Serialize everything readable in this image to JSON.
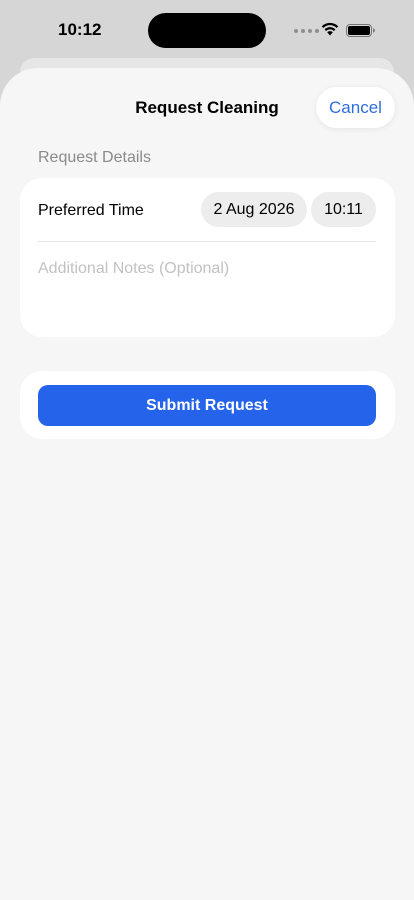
{
  "status_bar": {
    "time": "10:12",
    "icons": [
      "signal-dots-icon",
      "wifi-icon",
      "battery-icon"
    ]
  },
  "nav": {
    "title": "Request Cleaning",
    "cancel_label": "Cancel"
  },
  "details": {
    "section_header": "Request Details",
    "preferred_time_label": "Preferred Time",
    "date_value": "2 Aug 2026",
    "time_value": "10:11",
    "notes_value": "",
    "notes_placeholder": "Additional Notes (Optional)"
  },
  "submit": {
    "label": "Submit Request"
  },
  "colors": {
    "accent": "#2563eb",
    "link": "#2f6fdc",
    "background": "#f6f6f6"
  }
}
